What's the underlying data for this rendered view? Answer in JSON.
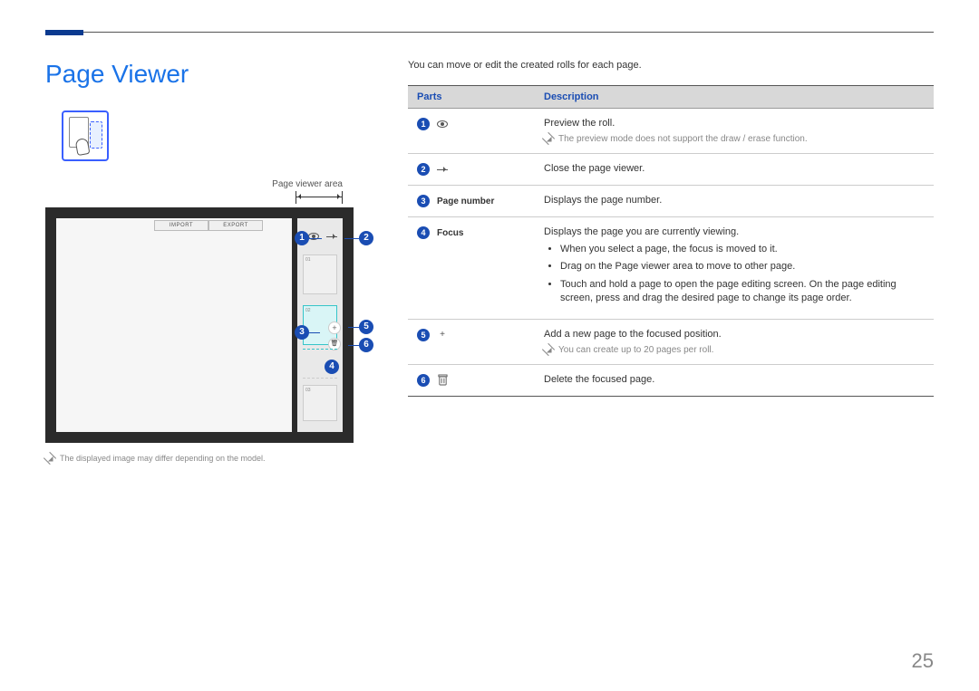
{
  "page_number": "25",
  "title": "Page Viewer",
  "left": {
    "area_label": "Page viewer area",
    "import_label": "IMPORT",
    "export_label": "EXPORT",
    "thumb1": "01",
    "thumb2": "02",
    "thumb3": "03",
    "model_note": "The displayed image may differ depending on the model."
  },
  "callouts": {
    "c1": "1",
    "c2": "2",
    "c3": "3",
    "c4": "4",
    "c5": "5",
    "c6": "6"
  },
  "right": {
    "intro": "You can move or edit the created rolls for each page.",
    "th_parts": "Parts",
    "th_desc": "Description",
    "rows": {
      "r1": {
        "num": "1",
        "desc_main": "Preview the roll.",
        "desc_note": "The preview mode does not support the draw / erase function."
      },
      "r2": {
        "num": "2",
        "desc_main": "Close the page viewer."
      },
      "r3": {
        "num": "3",
        "label": "Page number",
        "desc_main": "Displays the page number."
      },
      "r4": {
        "num": "4",
        "label": "Focus",
        "desc_main": "Displays the page you are currently viewing.",
        "b1": "When you select a page, the focus is moved to it.",
        "b2": "Drag on the Page viewer area to move to other page.",
        "b3": "Touch and hold a page to open the page editing screen. On the page editing screen, press and drag the desired page to change its page order."
      },
      "r5": {
        "num": "5",
        "desc_main": "Add a new page to the focused position.",
        "desc_note": "You can create up to 20 pages per roll."
      },
      "r6": {
        "num": "6",
        "desc_main": "Delete the focused page."
      }
    }
  }
}
